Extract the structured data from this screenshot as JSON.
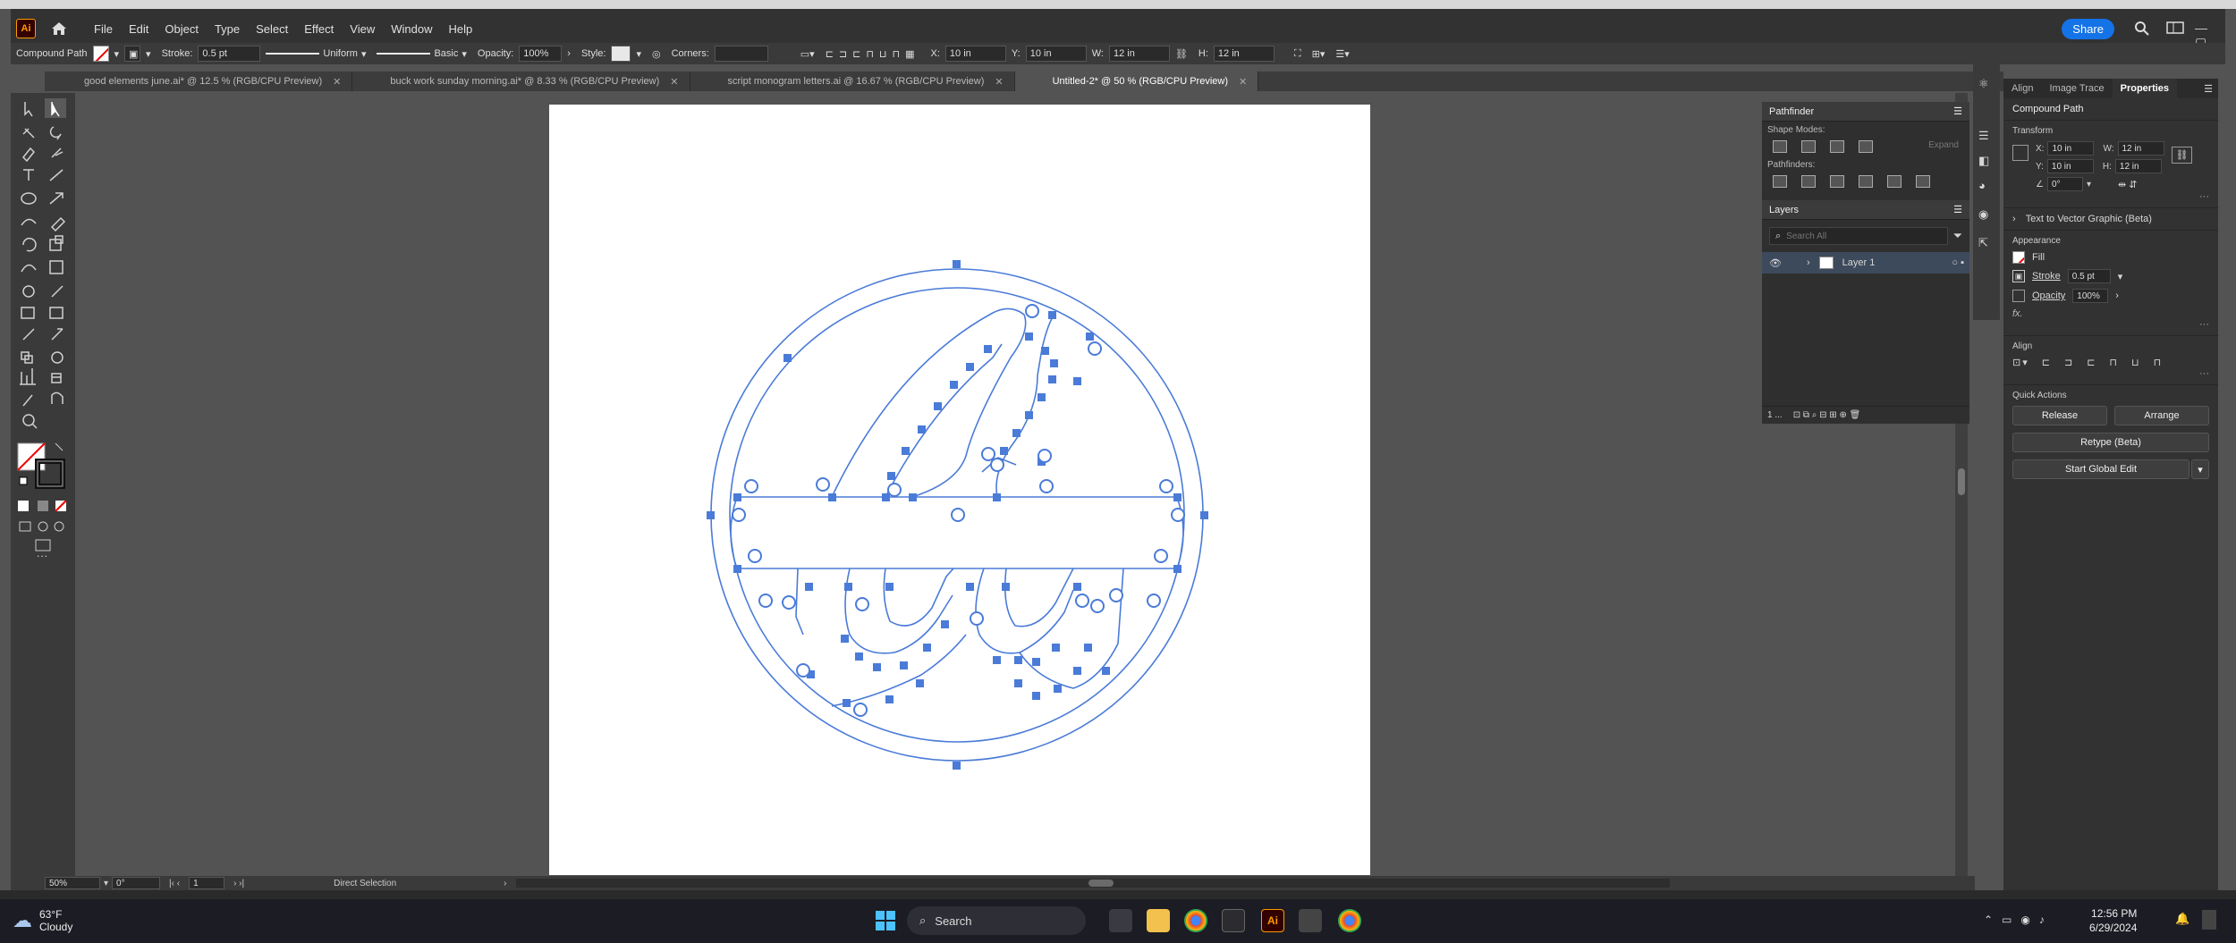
{
  "menu": {
    "items": [
      "File",
      "Edit",
      "Object",
      "Type",
      "Select",
      "Effect",
      "View",
      "Window",
      "Help"
    ],
    "share": "Share"
  },
  "control": {
    "object_type": "Compound Path",
    "stroke_label": "Stroke:",
    "stroke_value": "0.5 pt",
    "profile": "Uniform",
    "brush": "Basic",
    "opacity_label": "Opacity:",
    "opacity_value": "100%",
    "style_label": "Style:",
    "corners_label": "Corners:",
    "x_label": "X:",
    "x_value": "10 in",
    "y_label": "Y:",
    "y_value": "10 in",
    "w_label": "W:",
    "w_value": "12 in",
    "h_label": "H:",
    "h_value": "12 in"
  },
  "tabs": [
    {
      "label": "good elements june.ai* @ 12.5 % (RGB/CPU Preview)"
    },
    {
      "label": "buck work sunday morning.ai* @ 8.33 % (RGB/CPU Preview)"
    },
    {
      "label": "script monogram letters.ai @ 16.67 % (RGB/CPU Preview)"
    },
    {
      "label": "Untitled-2* @ 50 % (RGB/CPU Preview)"
    }
  ],
  "pathfinder": {
    "title": "Pathfinder",
    "shape_modes": "Shape Modes:",
    "expand": "Expand",
    "pathfinders": "Pathfinders:"
  },
  "layers": {
    "title": "Layers",
    "search_placeholder": "Search All",
    "layer_name": "Layer 1",
    "count": "1 ..."
  },
  "properties": {
    "tabs": [
      "Align",
      "Image Trace",
      "Properties"
    ],
    "object_type": "Compound Path",
    "transform": "Transform",
    "x_label": "X:",
    "x_value": "10 in",
    "y_label": "Y:",
    "y_value": "10 in",
    "w_label": "W:",
    "w_value": "12 in",
    "h_label": "H:",
    "h_value": "12 in",
    "angle_value": "0°",
    "text_to_vector": "Text to Vector Graphic (Beta)",
    "appearance": "Appearance",
    "fill": "Fill",
    "stroke": "Stroke",
    "stroke_value": "0.5 pt",
    "opacity": "Opacity",
    "opacity_value": "100%",
    "fx": "fx.",
    "align": "Align",
    "quick_actions": "Quick Actions",
    "release": "Release",
    "arrange": "Arrange",
    "retype": "Retype (Beta)",
    "global_edit": "Start Global Edit"
  },
  "status": {
    "zoom": "50%",
    "rotation": "0°",
    "artboard": "1",
    "tool": "Direct Selection"
  },
  "taskbar": {
    "temp": "63°F",
    "weather": "Cloudy",
    "search": "Search",
    "time": "12:56 PM",
    "date": "6/29/2024"
  },
  "colors": {
    "accent": "#1473e6",
    "path_blue": "#4a7bd8"
  }
}
